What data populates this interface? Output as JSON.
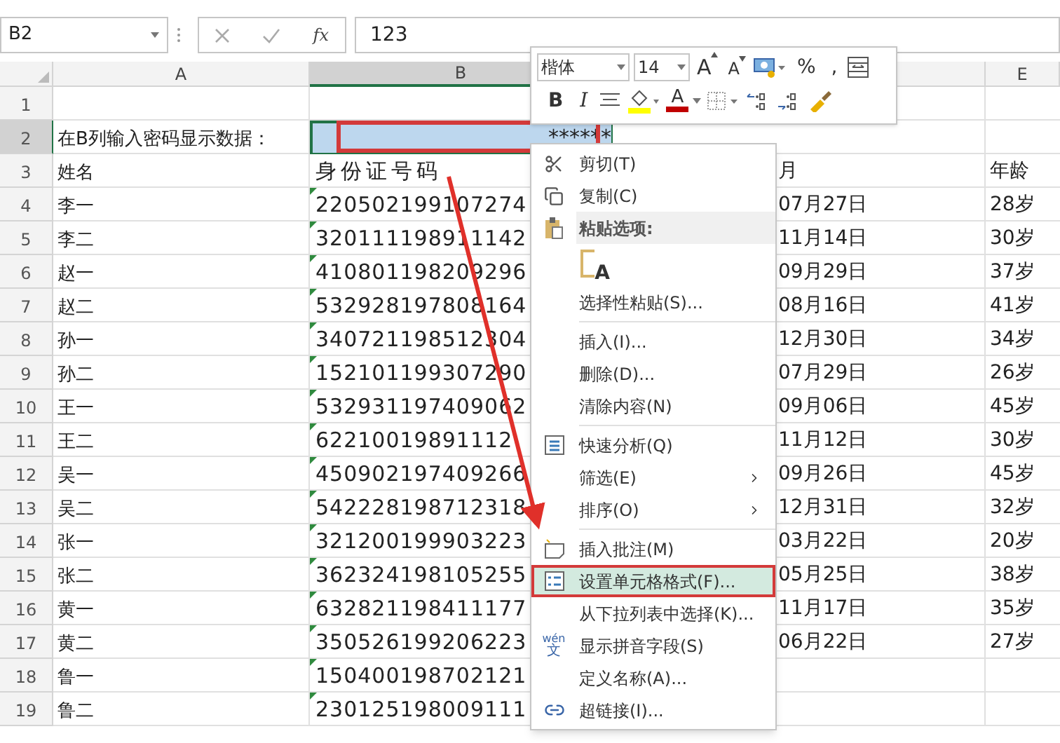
{
  "name_box": {
    "value": "B2"
  },
  "formula_bar": {
    "function_label": "fx",
    "value": "123"
  },
  "columns": [
    {
      "label": "A",
      "selected": false
    },
    {
      "label": "B",
      "selected": true
    },
    {
      "label": "E",
      "selected": false
    }
  ],
  "rows": [
    {
      "number": "1",
      "active": false
    },
    {
      "number": "2",
      "active": true,
      "a": "在B列输入密码显示数据：",
      "b": "******",
      "outlined": true
    },
    {
      "number": "3",
      "active": false,
      "a": "姓名",
      "b": "身份证号码",
      "c": "月",
      "e": "年龄"
    },
    {
      "number": "4",
      "active": false,
      "a": "李一",
      "b": "220502199107274",
      "c": "07月27日",
      "e": "28岁",
      "flag": true
    },
    {
      "number": "5",
      "active": false,
      "a": "李二",
      "b": "320111198911142",
      "c": "11月14日",
      "e": "30岁",
      "flag": true
    },
    {
      "number": "6",
      "active": false,
      "a": "赵一",
      "b": "410801198209296",
      "c": "09月29日",
      "e": "37岁",
      "flag": true
    },
    {
      "number": "7",
      "active": false,
      "a": "赵二",
      "b": "532928197808164",
      "c": "08月16日",
      "e": "41岁",
      "flag": true
    },
    {
      "number": "8",
      "active": false,
      "a": "孙一",
      "b": "340721198512304",
      "c": "12月30日",
      "e": "34岁",
      "flag": true
    },
    {
      "number": "9",
      "active": false,
      "a": "孙二",
      "b": "152101199307290",
      "c": "07月29日",
      "e": "26岁",
      "flag": true
    },
    {
      "number": "10",
      "active": false,
      "a": "王一",
      "b": "532931197409062",
      "c": "09月06日",
      "e": "45岁",
      "flag": true
    },
    {
      "number": "11",
      "active": false,
      "a": "王二",
      "b": "62210019891112",
      "c": "11月12日",
      "e": "30岁",
      "flag": true
    },
    {
      "number": "12",
      "active": false,
      "a": "吴一",
      "b": "450902197409266",
      "c": "09月26日",
      "e": "45岁",
      "flag": true
    },
    {
      "number": "13",
      "active": false,
      "a": "吴二",
      "b": "542228198712318",
      "c": "12月31日",
      "e": "32岁",
      "flag": true
    },
    {
      "number": "14",
      "active": false,
      "a": "张一",
      "b": "321200199903223",
      "c": "03月22日",
      "e": "20岁",
      "flag": true
    },
    {
      "number": "15",
      "active": false,
      "a": "张二",
      "b": "362324198105255",
      "c": "05月25日",
      "e": "38岁",
      "flag": true
    },
    {
      "number": "16",
      "active": false,
      "a": "黄一",
      "b": "632821198411177",
      "c": "11月17日",
      "e": "35岁",
      "flag": true
    },
    {
      "number": "17",
      "active": false,
      "a": "黄二",
      "b": "350526199206223",
      "c": "06月22日",
      "e": "27岁",
      "flag": true
    },
    {
      "number": "18",
      "active": false,
      "a": "鲁一",
      "b": "150400198702121",
      "flag": true
    },
    {
      "number": "19",
      "active": false,
      "a": "鲁二",
      "b": "230125198009111",
      "flag": true
    }
  ],
  "mini_toolbar": {
    "font": "楷体",
    "size": "14",
    "row1": [
      {
        "kind": "grow",
        "label": "A"
      },
      {
        "kind": "shrink",
        "label": "A"
      },
      {
        "kind": "currency"
      },
      {
        "kind": "percent",
        "label": "%"
      },
      {
        "kind": "comma",
        "label": ","
      },
      {
        "kind": "wrap"
      }
    ],
    "row2": [
      {
        "kind": "bold",
        "label": "B"
      },
      {
        "kind": "italic",
        "label": "I"
      },
      {
        "kind": "align"
      },
      {
        "kind": "fill",
        "color": "#ffff00"
      },
      {
        "kind": "font_color",
        "label": "A",
        "color": "#c00000"
      },
      {
        "kind": "borders"
      },
      {
        "kind": "inc_decimal"
      },
      {
        "kind": "dec_decimal"
      },
      {
        "kind": "painter"
      }
    ]
  },
  "context_menu": [
    {
      "kind": "item",
      "label": "剪切(T)",
      "submenu": false,
      "highlighted": false,
      "outlined": false
    },
    {
      "kind": "item",
      "label": "复制(C)",
      "submenu": false,
      "highlighted": false,
      "outlined": false
    },
    {
      "kind": "header",
      "label": "粘贴选项:"
    },
    {
      "kind": "paste_icons",
      "letter": "A"
    },
    {
      "kind": "item",
      "label": "选择性粘贴(S)...",
      "submenu": false,
      "highlighted": false,
      "outlined": false
    },
    {
      "kind": "divider"
    },
    {
      "kind": "item",
      "label": "插入(I)...",
      "submenu": false,
      "highlighted": false,
      "outlined": false
    },
    {
      "kind": "item",
      "label": "删除(D)...",
      "submenu": false,
      "highlighted": false,
      "outlined": false
    },
    {
      "kind": "item",
      "label": "清除内容(N)",
      "submenu": false,
      "highlighted": false,
      "outlined": false
    },
    {
      "kind": "divider"
    },
    {
      "kind": "item",
      "label": "快速分析(Q)",
      "submenu": false,
      "highlighted": false,
      "outlined": false
    },
    {
      "kind": "item",
      "label": "筛选(E)",
      "submenu": true,
      "highlighted": false,
      "outlined": false
    },
    {
      "kind": "item",
      "label": "排序(O)",
      "submenu": true,
      "highlighted": false,
      "outlined": false
    },
    {
      "kind": "divider"
    },
    {
      "kind": "item",
      "label": "插入批注(M)",
      "submenu": false,
      "highlighted": false,
      "outlined": false
    },
    {
      "kind": "item",
      "label": "设置单元格格式(F)...",
      "submenu": false,
      "highlighted": true,
      "outlined": true
    },
    {
      "kind": "item",
      "label": "从下拉列表中选择(K)...",
      "submenu": false,
      "highlighted": false,
      "outlined": false
    },
    {
      "kind": "item",
      "label": "显示拼音字段(S)",
      "icon_top": "wén",
      "icon_bottom": "文",
      "submenu": false,
      "highlighted": false,
      "outlined": false
    },
    {
      "kind": "item",
      "label": "定义名称(A)...",
      "submenu": false,
      "highlighted": false,
      "outlined": false
    },
    {
      "kind": "item",
      "label": "超链接(I)...",
      "submenu": false,
      "highlighted": false,
      "outlined": false
    }
  ]
}
